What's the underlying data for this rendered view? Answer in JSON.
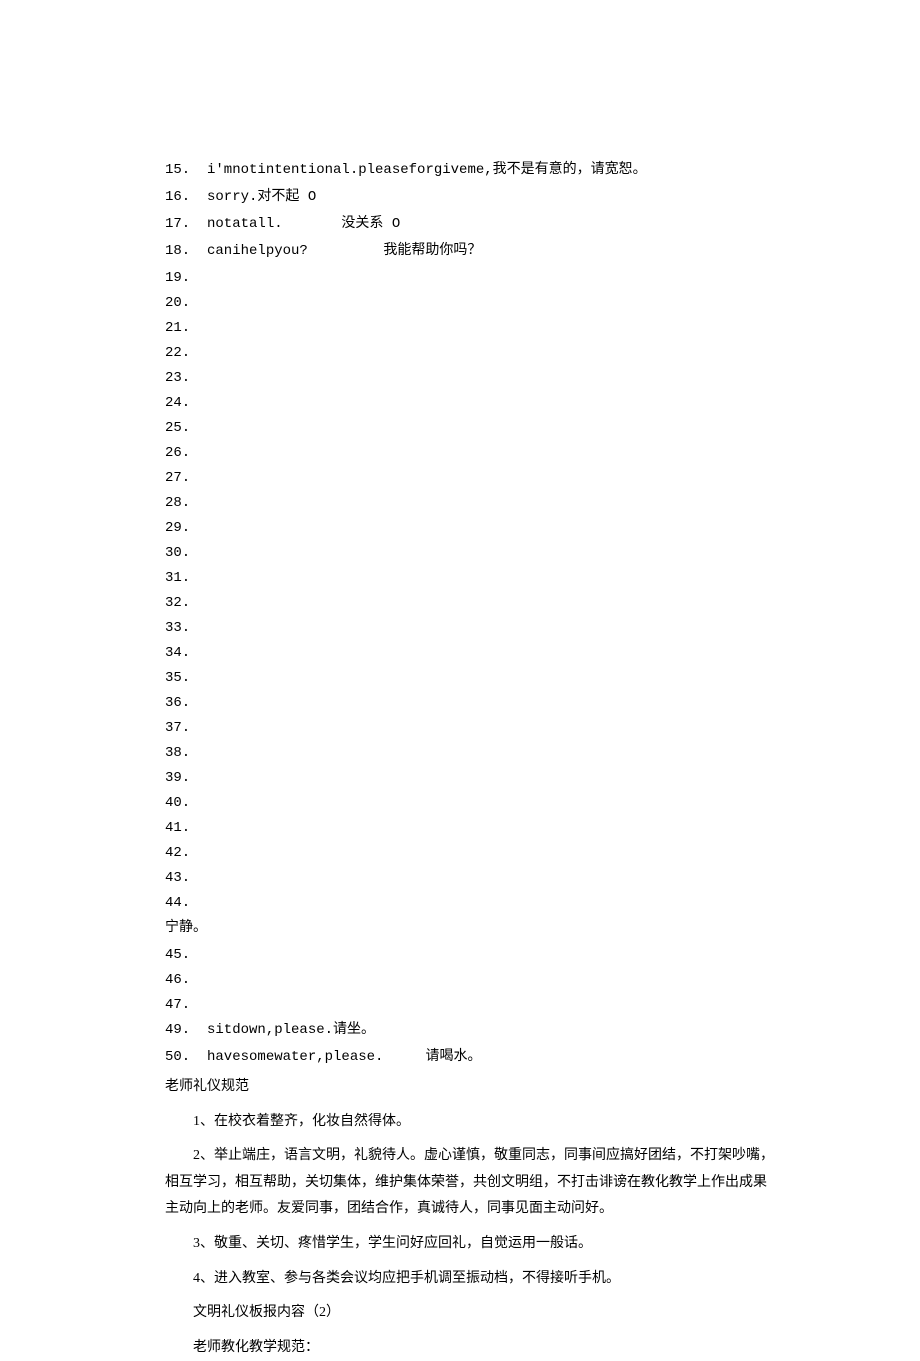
{
  "items": [
    "15.  i'mnotintentional.pleaseforgiveme,我不是有意的，请宽恕。",
    "16.  sorry.对不起 O",
    "17.  notatall.       没关系 O",
    "18.  canihelpyou?         我能帮助你吗？",
    "19.",
    "20.",
    "21.",
    "22.",
    "23.",
    "24.",
    "25.",
    "26.",
    "27.",
    "28.",
    "29.",
    "30.",
    "31.",
    "32.",
    "33.",
    "34.",
    "35.",
    "36.",
    "37.",
    "38.",
    "39.",
    "40.",
    "41.",
    "42.",
    "43.",
    "44.",
    "宁静。",
    "45.",
    "46.",
    "47.",
    "49.  sitdown,please.请坐。",
    "50.  havesomewater,please.     请喝水。"
  ],
  "sectionHeader": "老师礼仪规范",
  "paragraphs": [
    "1、在校衣着整齐，化妆自然得体。",
    "2、举止端庄，语言文明，礼貌待人。虚心谨慎，敬重同志，同事间应搞好团结，不打架吵嘴，相互学习，相互帮助，关切集体，维护集体荣誉，共创文明组，不打击诽谤在教化教学上作出成果主动向上的老师。友爱同事，团结合作，真诚待人，同事见面主动问好。",
    "3、敬重、关切、疼惜学生，学生问好应回礼，自觉运用一般话。",
    "4、进入教室、参与各类会议均应把手机调至振动档，不得接听手机。",
    "文明礼仪板报内容（2）",
    "老师教化教学规范："
  ]
}
